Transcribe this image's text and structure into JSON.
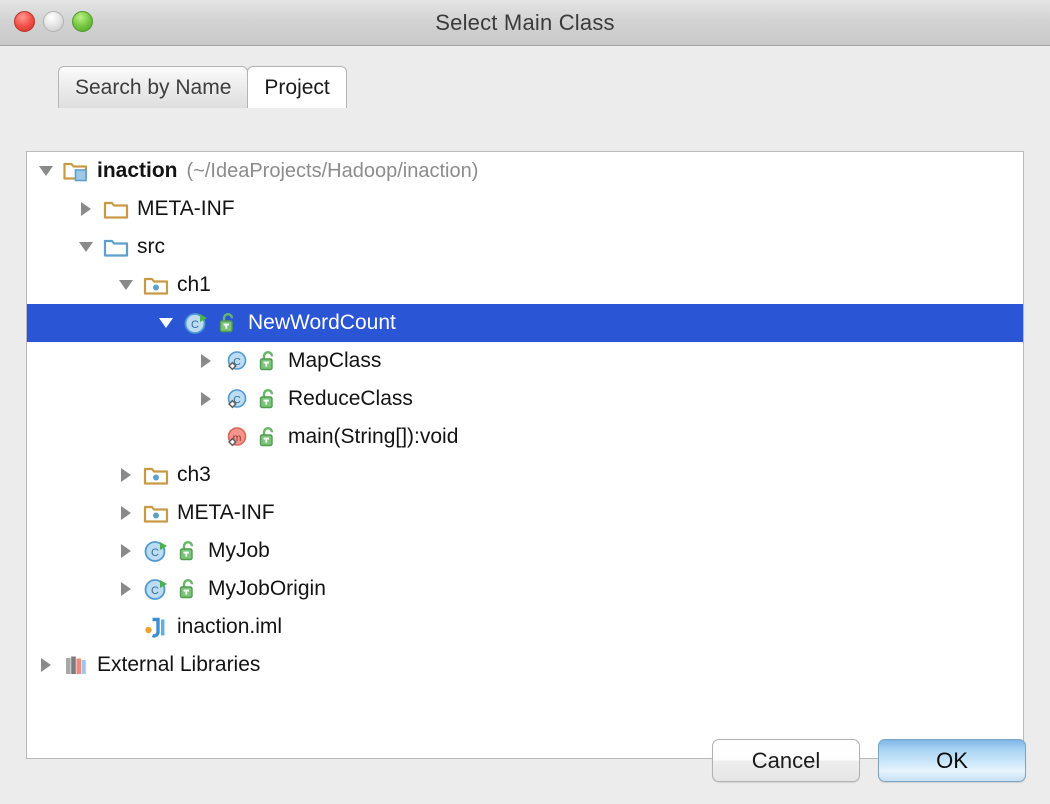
{
  "window": {
    "title": "Select Main Class",
    "controls": [
      {
        "name": "close",
        "label": "Close"
      },
      {
        "name": "minimize",
        "label": "Minimize"
      },
      {
        "name": "maximize",
        "label": "Maximize"
      }
    ]
  },
  "tabs": [
    {
      "label": "Search by Name",
      "active": false
    },
    {
      "label": "Project",
      "active": true
    }
  ],
  "tree": {
    "rows": [
      {
        "label": "inaction",
        "sublabel": "(~/IdeaProjects/Hadoop/inaction)",
        "indent": 0,
        "twisty": "expanded",
        "icon": "folder-module-icon",
        "lock": "none",
        "bold": true,
        "selected": false
      },
      {
        "label": "META-INF",
        "sublabel": "",
        "indent": 1,
        "twisty": "collapsed",
        "icon": "folder-plain-icon",
        "lock": "none",
        "bold": false,
        "selected": false
      },
      {
        "label": "src",
        "sublabel": "",
        "indent": 1,
        "twisty": "expanded",
        "icon": "folder-source-root-icon",
        "lock": "none",
        "bold": false,
        "selected": false
      },
      {
        "label": "ch1",
        "sublabel": "",
        "indent": 2,
        "twisty": "expanded",
        "icon": "folder-package-icon",
        "lock": "none",
        "bold": false,
        "selected": false
      },
      {
        "label": "NewWordCount",
        "sublabel": "",
        "indent": 3,
        "twisty": "expanded",
        "icon": "class-runnable-icon",
        "lock": "unlock-green-icon",
        "bold": false,
        "selected": true
      },
      {
        "label": "MapClass",
        "sublabel": "",
        "indent": 4,
        "twisty": "collapsed",
        "icon": "inner-class-icon",
        "lock": "unlock-green-icon",
        "bold": false,
        "selected": false
      },
      {
        "label": "ReduceClass",
        "sublabel": "",
        "indent": 4,
        "twisty": "collapsed",
        "icon": "inner-class-icon",
        "lock": "unlock-green-icon",
        "bold": false,
        "selected": false
      },
      {
        "label": "main(String[]):void",
        "sublabel": "",
        "indent": 4,
        "twisty": "none",
        "icon": "method-icon",
        "lock": "unlock-green-icon",
        "bold": false,
        "selected": false
      },
      {
        "label": "ch3",
        "sublabel": "",
        "indent": 2,
        "twisty": "collapsed",
        "icon": "folder-package-icon",
        "lock": "none",
        "bold": false,
        "selected": false
      },
      {
        "label": "META-INF",
        "sublabel": "",
        "indent": 2,
        "twisty": "collapsed",
        "icon": "folder-package-icon",
        "lock": "none",
        "bold": false,
        "selected": false
      },
      {
        "label": "MyJob",
        "sublabel": "",
        "indent": 2,
        "twisty": "collapsed",
        "icon": "class-runnable-icon",
        "lock": "unlock-green-icon",
        "bold": false,
        "selected": false
      },
      {
        "label": "MyJobOrigin",
        "sublabel": "",
        "indent": 2,
        "twisty": "collapsed",
        "icon": "class-runnable-icon",
        "lock": "unlock-green-icon",
        "bold": false,
        "selected": false
      },
      {
        "label": "inaction.iml",
        "sublabel": "",
        "indent": 2,
        "twisty": "none",
        "icon": "iml-file-icon",
        "lock": "none",
        "bold": false,
        "selected": false
      },
      {
        "label": "External Libraries",
        "sublabel": "",
        "indent": 0,
        "twisty": "collapsed",
        "icon": "external-libraries-icon",
        "lock": "none",
        "bold": false,
        "selected": false
      }
    ]
  },
  "buttons": {
    "cancel_label": "Cancel",
    "ok_label": "OK"
  },
  "colors": {
    "selection_blue": "#2a55d4",
    "titlebar": "#d2d2d2",
    "dialog_bg": "#ececec",
    "folder_tan": "#d2a349",
    "folder_blue": "#6aa9d4",
    "class_blue": "#5aa3dc",
    "method_pink": "#f08b80",
    "lock_green": "#5cb85c"
  }
}
